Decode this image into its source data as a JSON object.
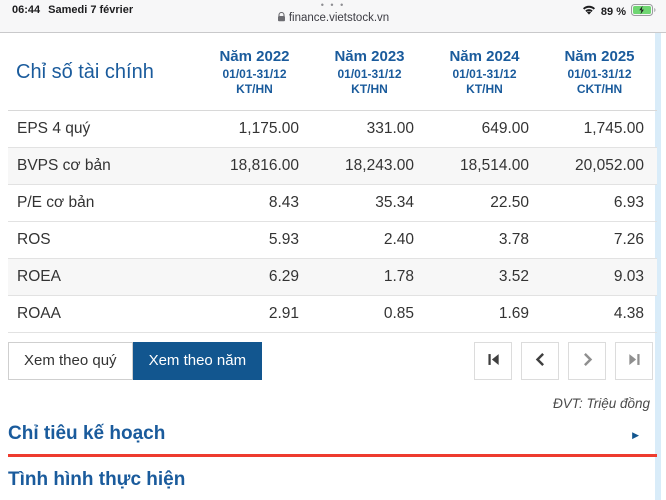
{
  "status_bar": {
    "time": "06:44",
    "date": "Samedi 7 février",
    "tab_dots": "• • •",
    "url": "finance.vietstock.vn",
    "battery_percent": "89 %",
    "icons": [
      "lock-icon",
      "wifi-icon",
      "battery-charging-icon"
    ]
  },
  "table": {
    "title": "Chỉ số tài chính",
    "columns": [
      {
        "year": "Năm 2022",
        "period": "01/01-31/12",
        "type": "KT/HN"
      },
      {
        "year": "Năm 2023",
        "period": "01/01-31/12",
        "type": "KT/HN"
      },
      {
        "year": "Năm 2024",
        "period": "01/01-31/12",
        "type": "KT/HN"
      },
      {
        "year": "Năm 2025",
        "period": "01/01-31/12",
        "type": "CKT/HN"
      }
    ],
    "rows": [
      {
        "label": "EPS 4 quý",
        "values": [
          "1,175.00",
          "331.00",
          "649.00",
          "1,745.00"
        ]
      },
      {
        "label": "BVPS cơ bản",
        "values": [
          "18,816.00",
          "18,243.00",
          "18,514.00",
          "20,052.00"
        ]
      },
      {
        "label": "P/E cơ bản",
        "values": [
          "8.43",
          "35.34",
          "22.50",
          "6.93"
        ]
      },
      {
        "label": "ROS",
        "values": [
          "5.93",
          "2.40",
          "3.78",
          "7.26"
        ]
      },
      {
        "label": "ROEA",
        "values": [
          "6.29",
          "1.78",
          "3.52",
          "9.03"
        ]
      },
      {
        "label": "ROAA",
        "values": [
          "2.91",
          "0.85",
          "1.69",
          "4.38"
        ]
      }
    ]
  },
  "controls": {
    "quarter_button": "Xem theo quý",
    "year_button": "Xem theo năm",
    "pager_icons": [
      "first-page-icon",
      "previous-page-icon",
      "next-page-icon",
      "last-page-icon"
    ]
  },
  "unit_note": "ĐVT: Triệu đồng",
  "sections": [
    {
      "title": "Chỉ tiêu kế hoạch"
    },
    {
      "title": "Tình hình thực hiện"
    }
  ],
  "colors": {
    "brand_blue": "#1a5b9c",
    "active_button_blue": "#12568f",
    "red_rule": "#ee3b2e",
    "battery_green": "#6fd672"
  }
}
